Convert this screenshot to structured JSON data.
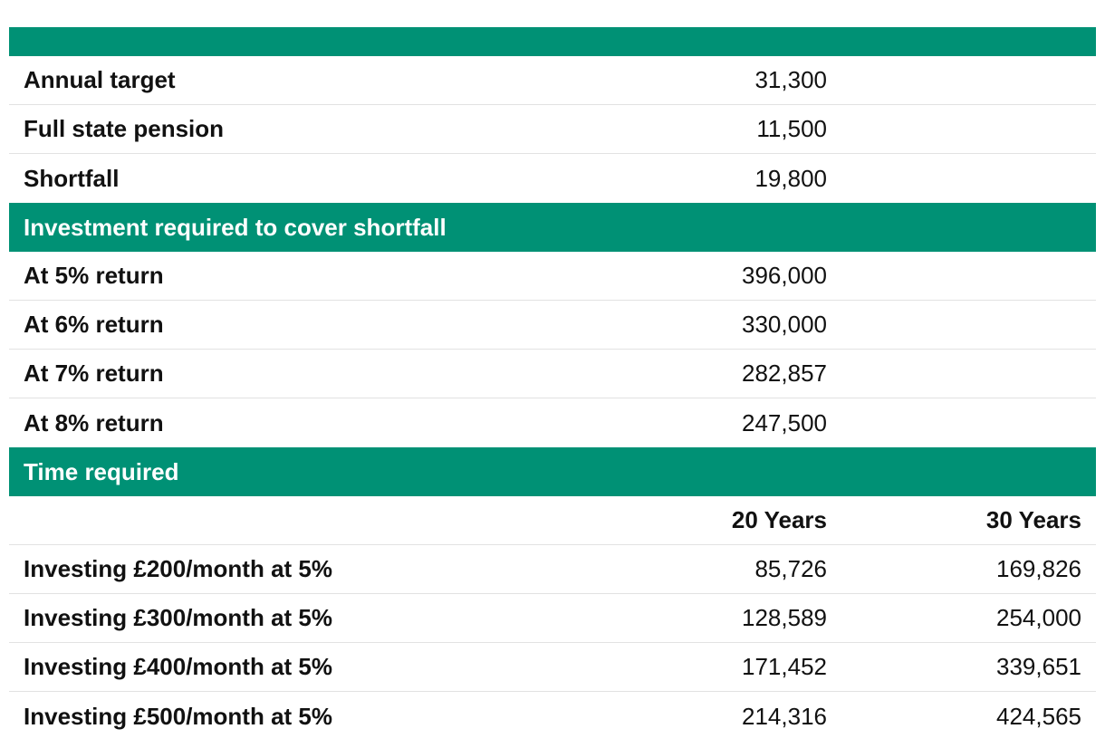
{
  "colors": {
    "header_band": "#009175",
    "header_text": "#ffffff",
    "row_divider": "#e2e2e2",
    "body_text": "#111111"
  },
  "top_section": {
    "rows": [
      {
        "label": "Annual target",
        "value": "31,300"
      },
      {
        "label": "Full state pension",
        "value": "11,500"
      },
      {
        "label": "Shortfall",
        "value": "19,800"
      }
    ]
  },
  "investment_section": {
    "heading": "Investment required to cover shortfall",
    "rows": [
      {
        "label": "At 5% return",
        "value": "396,000"
      },
      {
        "label": "At 6% return",
        "value": "330,000"
      },
      {
        "label": "At 7% return",
        "value": "282,857"
      },
      {
        "label": "At 8% return",
        "value": "247,500"
      }
    ]
  },
  "time_section": {
    "heading": "Time required",
    "col_20": "20 Years",
    "col_30": "30 Years",
    "rows": [
      {
        "label": "Investing £200/month at 5%",
        "v20": "85,726",
        "v30": "169,826"
      },
      {
        "label": "Investing £300/month at 5%",
        "v20": "128,589",
        "v30": "254,000"
      },
      {
        "label": "Investing £400/month at 5%",
        "v20": "171,452",
        "v30": "339,651"
      },
      {
        "label": "Investing £500/month at 5%",
        "v20": "214,316",
        "v30": "424,565"
      }
    ]
  }
}
